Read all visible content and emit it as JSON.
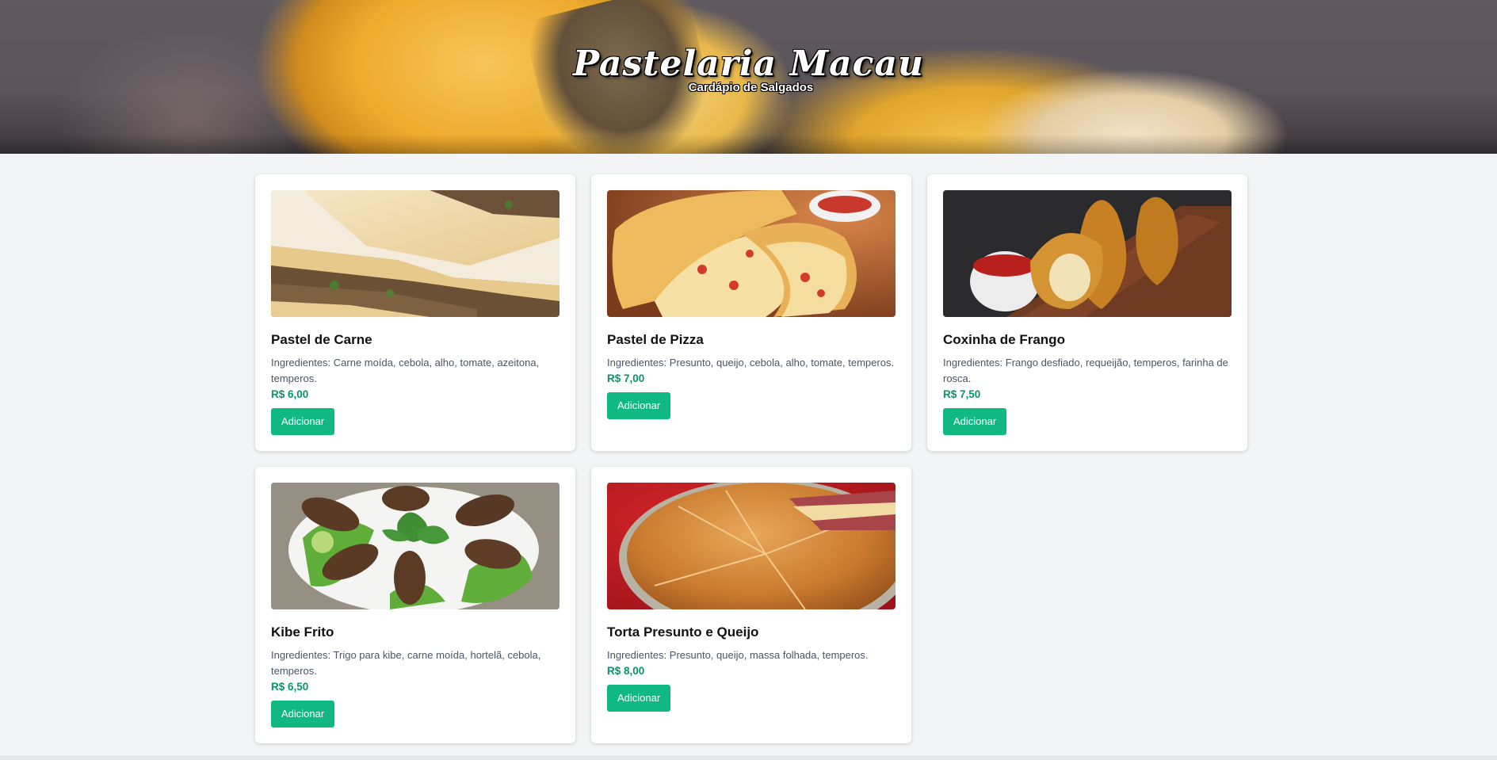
{
  "header": {
    "title": "Pastelaria Macau",
    "subtitle": "Cardápio de Salgados"
  },
  "add_label": "Adicionar",
  "products": [
    {
      "name": "Pastel de Carne",
      "description": "Ingredientes: Carne moída, cebola, alho, tomate, azeitona, temperos.",
      "price": "R$ 6,00",
      "button": "Adicionar"
    },
    {
      "name": "Pastel de Pizza",
      "description": "Ingredientes: Presunto, queijo, cebola, alho, tomate, temperos.",
      "price": "R$ 7,00",
      "button": "Adicionar"
    },
    {
      "name": "Coxinha de Frango",
      "description": "Ingredientes: Frango desfiado, requeijão, temperos, farinha de rosca.",
      "price": "R$ 7,50",
      "button": "Adicionar"
    },
    {
      "name": "Kibe Frito",
      "description": "Ingredientes: Trigo para kibe, carne moída, hortelã, cebola, temperos.",
      "price": "R$ 6,50",
      "button": "Adicionar"
    },
    {
      "name": "Torta Presunto e Queijo",
      "description": "Ingredientes: Presunto, queijo, massa folhada, temperos.",
      "price": "R$ 8,00",
      "button": "Adicionar"
    }
  ],
  "colors": {
    "accent": "#10b981",
    "price": "#059669",
    "background": "#f3f4f6"
  }
}
